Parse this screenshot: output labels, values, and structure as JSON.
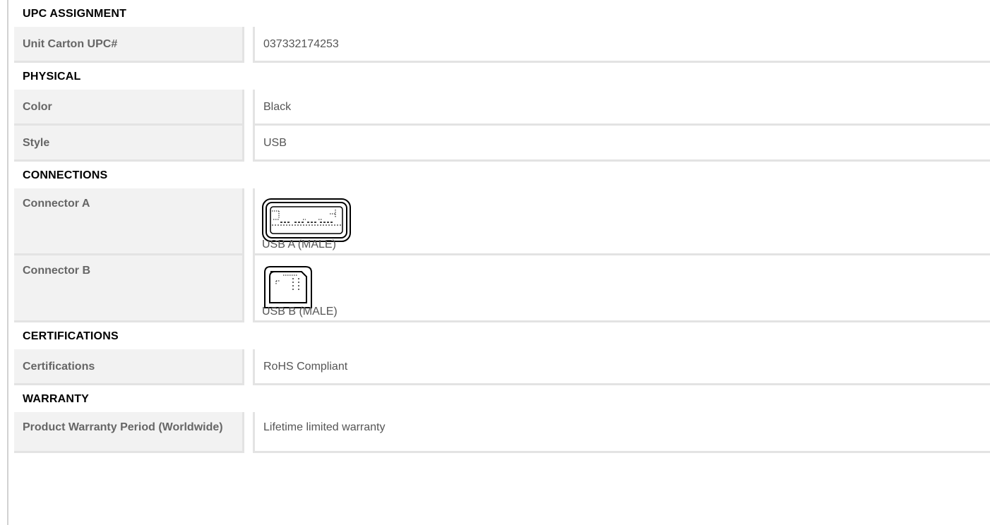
{
  "sections": {
    "upc": {
      "title": "UPC ASSIGNMENT",
      "rows": [
        {
          "label": "Unit Carton UPC#",
          "value": "037332174253"
        }
      ]
    },
    "physical": {
      "title": "PHYSICAL",
      "rows": [
        {
          "label": "Color",
          "value": "Black"
        },
        {
          "label": "Style",
          "value": "USB"
        }
      ]
    },
    "connections": {
      "title": "CONNECTIONS",
      "rows": [
        {
          "label": "Connector A",
          "value": "USB A (MALE)",
          "icon": "usb-a-connector-icon"
        },
        {
          "label": "Connector B",
          "value": "USB B (MALE)",
          "icon": "usb-b-connector-icon"
        }
      ]
    },
    "certifications": {
      "title": "CERTIFICATIONS",
      "rows": [
        {
          "label": "Certifications",
          "value": "RoHS Compliant"
        }
      ]
    },
    "warranty": {
      "title": "WARRANTY",
      "rows": [
        {
          "label": "Product Warranty Period (Worldwide)",
          "value": "Lifetime limited warranty"
        }
      ]
    }
  },
  "colors": {
    "label_bg": "#f2f2f2",
    "divider": "#e3e3e3",
    "label_text": "#666666",
    "value_text": "#555555"
  }
}
